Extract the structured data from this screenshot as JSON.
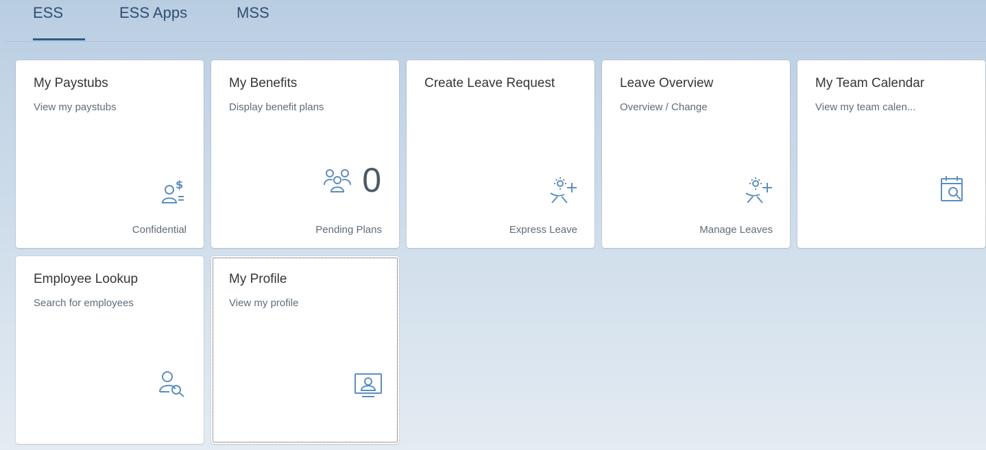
{
  "tabs": [
    {
      "label": "ESS",
      "active": true
    },
    {
      "label": "ESS Apps",
      "active": false
    },
    {
      "label": "MSS",
      "active": false
    }
  ],
  "tiles": [
    {
      "title": "My Paystubs",
      "subtitle": "View my paystubs",
      "icon": "employee-payment-icon",
      "footer": "Confidential"
    },
    {
      "title": "My Benefits",
      "subtitle": "Display benefit plans",
      "icon": "group-icon",
      "kpi": "0",
      "footer": "Pending Plans"
    },
    {
      "title": "Create Leave Request",
      "subtitle": "",
      "icon": "leave-request-icon",
      "footer": "Express Leave"
    },
    {
      "title": "Leave Overview",
      "subtitle": "Overview / Change",
      "icon": "leave-request-icon",
      "footer": "Manage Leaves"
    },
    {
      "title": "My Team Calendar",
      "subtitle": "View my team calen...",
      "icon": "calendar-search-icon",
      "footer": ""
    },
    {
      "title": "Employee Lookup",
      "subtitle": "Search for employees",
      "icon": "employee-lookup-icon",
      "footer": ""
    },
    {
      "title": "My Profile",
      "subtitle": "View my profile",
      "icon": "profile-card-icon",
      "footer": ""
    }
  ],
  "colors": {
    "icon": "#5a8dc2",
    "accent": "#2d5a84"
  }
}
